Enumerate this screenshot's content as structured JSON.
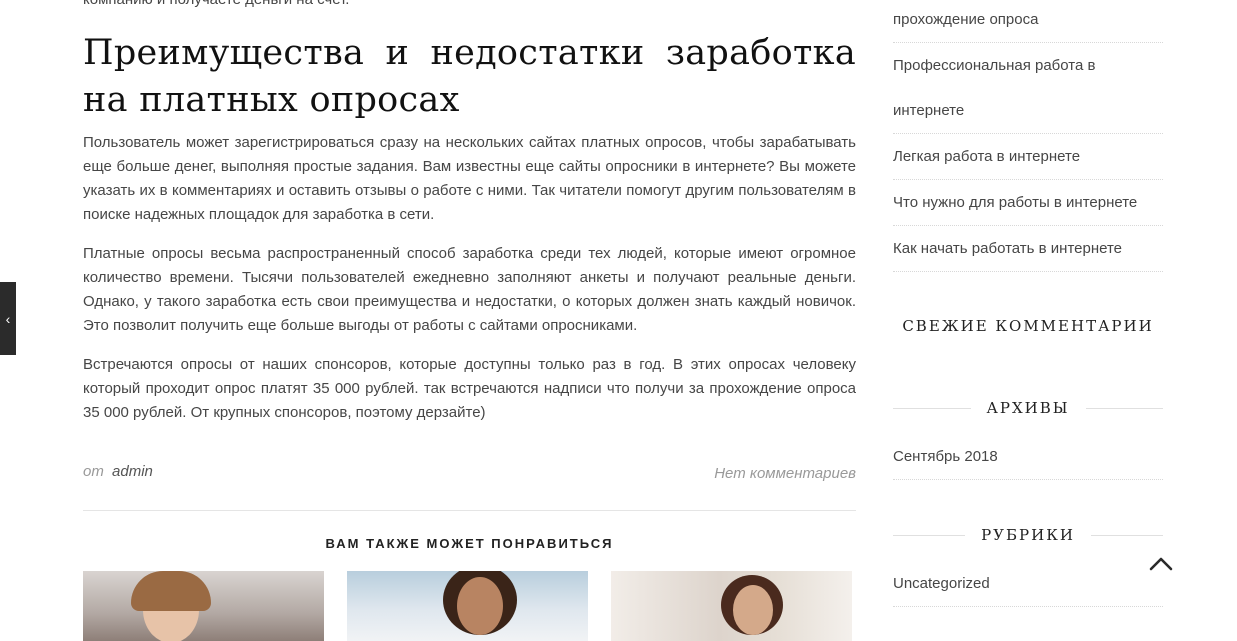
{
  "article": {
    "cut_line": "компанию и получаете деньги на счет.",
    "title": "Преимущества и недостатки заработка на платных опросах",
    "paragraphs": [
      "Пользователь может зарегистрироваться сразу на нескольких сайтах платных опросов, чтобы зарабатывать еще больше денег, выполняя простые задания. Вам известны еще сайты опросники в интернете? Вы можете указать их в комментариях и оставить отзывы о работе с ними. Так читатели помогут другим пользователям в поиске надежных площадок для заработка в сети.",
      "Платные опросы весьма распространенный способ заработка среди тех людей, которые имеют огромное количество времени. Тысячи пользователей ежедневно заполняют анкеты и получают реальные деньги. Однако, у такого заработка есть свои преимущества и недостатки, о которых должен знать каждый новичок. Это позволит получить еще больше выгоды от работы с сайтами опросниками.",
      "Встречаются опросы от наших спонсоров, которые доступны только раз в год. В этих опросах человеку который проходит опрос платят 35 000 рублей. так встречаются надписи что получи за прохождение опроса 35 000 рублей. От крупных спонсоров, поэтому дерзайте)"
    ],
    "meta": {
      "by": "от",
      "author": "admin",
      "comments": "Нет комментариев"
    }
  },
  "related": {
    "title": "ВАМ ТАКЖЕ МОЖЕТ ПОНРАВИТЬСЯ"
  },
  "sidebar": {
    "recent_posts": [
      "прохождение опроса",
      "Профессиональная работа в",
      "интернете",
      "Легкая работа в интернете",
      "Что нужно для работы в интернете",
      "Как начать работать в интернете"
    ],
    "comments_title": "СВЕЖИЕ КОММЕНТАРИИ",
    "archives_title": "АРХИВЫ",
    "archives": [
      "Сентябрь 2018"
    ],
    "categories_title": "РУБРИКИ",
    "categories": [
      "Uncategorized"
    ]
  },
  "icons": {
    "side_tab": "chevron-left-icon",
    "back_to_top": "chevron-up-icon"
  }
}
